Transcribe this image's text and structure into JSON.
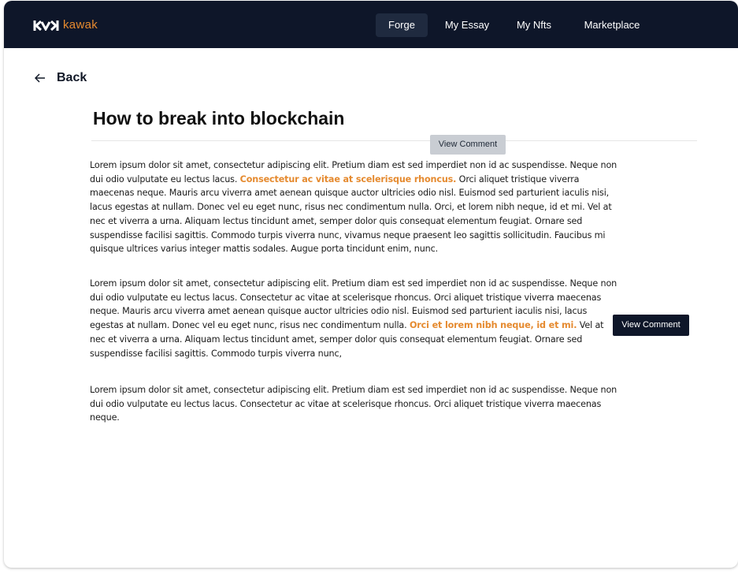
{
  "brand": {
    "name": "kawak",
    "accent_color": "#e58a2f",
    "navbar_color": "#0e1629",
    "logo_icon": "kawak-logo-icon"
  },
  "nav": {
    "items": [
      {
        "label": "Forge",
        "active": true
      },
      {
        "label": "My Essay",
        "active": false
      },
      {
        "label": "My Nfts",
        "active": false
      },
      {
        "label": "Marketplace",
        "active": false
      }
    ]
  },
  "back": {
    "label": "Back",
    "icon": "arrow-left-icon"
  },
  "article": {
    "title": "How to break into blockchain",
    "view_comment_label": "View Comment",
    "paragraphs": [
      {
        "before": "Lorem ipsum dolor sit amet, consectetur adipiscing elit. Pretium diam est sed imperdiet non id ac suspendisse. Neque non dui odio vulputate eu lectus lacus. ",
        "highlight": "Consectetur ac vitae at scelerisque rhoncus.",
        "after": " Orci aliquet tristique viverra maecenas neque. Mauris arcu viverra amet aenean quisque auctor ultricies odio nisl. Euismod sed parturient iaculis nisi, lacus egestas at nullam. Donec vel eu eget nunc, risus nec condimentum nulla. Orci, et lorem nibh neque, id et mi. Vel at nec et viverra a urna. Aliquam lectus tincidunt amet, semper dolor quis consequat elementum feugiat. Ornare sed suspendisse facilisi sagittis. Commodo turpis viverra nunc, vivamus neque praesent leo sagittis sollicitudin. Faucibus mi quisque ultrices varius integer mattis sodales. Augue porta tincidunt enim, nunc."
      },
      {
        "before": "Lorem ipsum dolor sit amet, consectetur adipiscing elit. Pretium diam est sed imperdiet non id ac suspendisse. Neque non dui odio vulputate eu lectus lacus. Consectetur ac vitae at scelerisque rhoncus. Orci aliquet tristique viverra maecenas neque. Mauris arcu viverra amet aenean quisque auctor ultricies odio nisl. Euismod sed parturient iaculis nisi, lacus egestas at nullam. Donec vel eu eget nunc, risus nec condimentum nulla. ",
        "highlight": "Orci et lorem nibh neque, id et mi.",
        "after": " Vel at nec et viverra a urna. Aliquam lectus tincidunt amet, semper dolor quis consequat elementum feugiat. Ornare sed suspendisse facilisi sagittis. Commodo turpis viverra nunc,"
      },
      {
        "text": "Lorem ipsum dolor sit amet, consectetur adipiscing elit. Pretium diam est sed imperdiet non id ac suspendisse. Neque non dui odio vulputate eu lectus lacus. Consectetur ac vitae at scelerisque rhoncus. Orci aliquet tristique viverra maecenas neque."
      }
    ]
  }
}
